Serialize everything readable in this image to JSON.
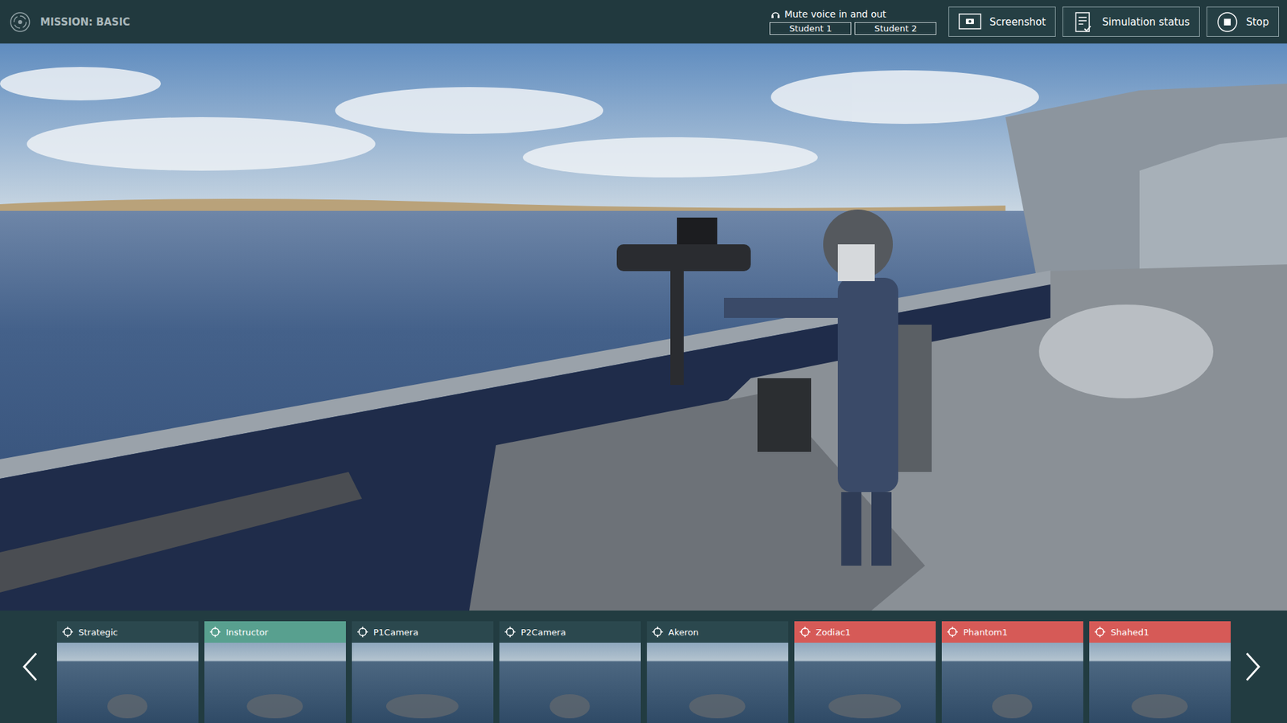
{
  "mission": "MISSION: BASIC",
  "voice": {
    "label": "Mute voice in and out",
    "students": [
      {
        "label": "Student 1"
      },
      {
        "label": "Student 2"
      }
    ]
  },
  "buttons": [
    {
      "label": "Screenshot",
      "kind": "screenshot"
    },
    {
      "label": "Simulation status",
      "kind": "status"
    },
    {
      "label": "Stop",
      "kind": "stop"
    }
  ],
  "cameras": [
    {
      "label": "Strategic",
      "selected": false,
      "color": "#2b484e"
    },
    {
      "label": "Instructor",
      "selected": true,
      "color": "#2b484e"
    },
    {
      "label": "P1Camera",
      "selected": false,
      "color": "#2b484e"
    },
    {
      "label": "P2Camera",
      "selected": false,
      "color": "#2b484e"
    },
    {
      "label": "Akeron",
      "selected": false,
      "color": "#2b484e"
    },
    {
      "label": "Zodiac1",
      "selected": false,
      "color": "#d65a57"
    },
    {
      "label": "Phantom1",
      "selected": false,
      "color": "#d65a57"
    },
    {
      "label": "Shahed1",
      "selected": false,
      "color": "#d65a57"
    }
  ]
}
